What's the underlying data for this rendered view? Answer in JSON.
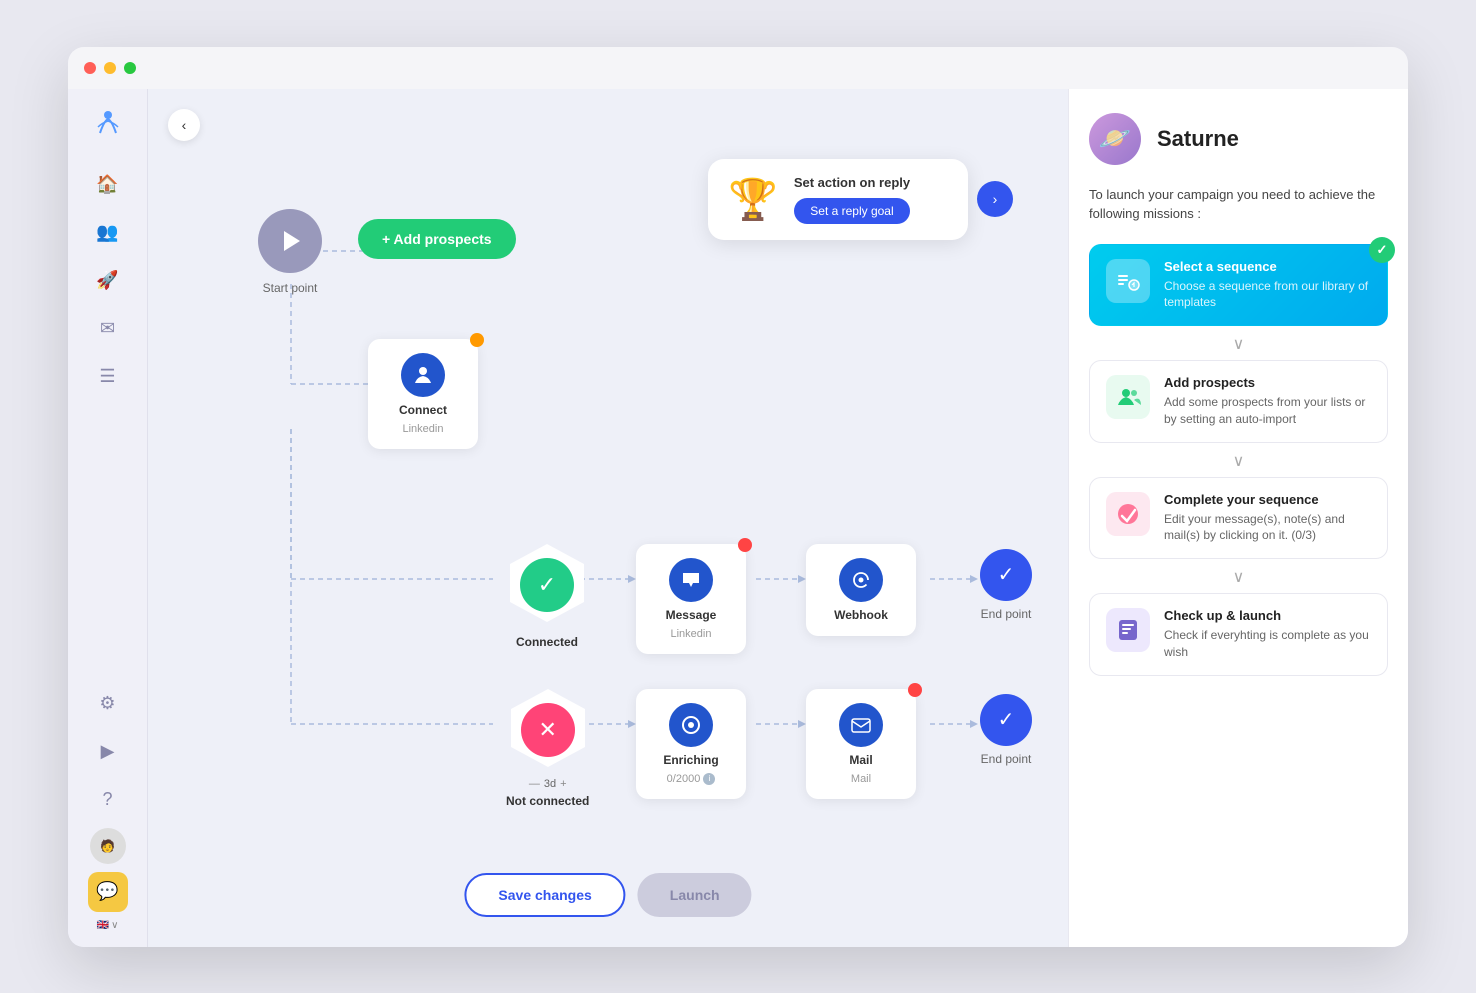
{
  "window": {
    "dots": [
      "red",
      "yellow",
      "green"
    ]
  },
  "sidebar": {
    "logo": "🦅",
    "icons": [
      {
        "name": "home-icon",
        "glyph": "⌂",
        "active": false
      },
      {
        "name": "users-icon",
        "glyph": "👥",
        "active": false
      },
      {
        "name": "rocket-icon",
        "glyph": "🚀",
        "active": true
      },
      {
        "name": "mail-icon",
        "glyph": "✉",
        "active": false
      },
      {
        "name": "list-icon",
        "glyph": "☰",
        "active": false
      },
      {
        "name": "settings-icon",
        "glyph": "⚙",
        "active": false
      },
      {
        "name": "play-icon",
        "glyph": "▶",
        "active": false
      },
      {
        "name": "help-icon",
        "glyph": "?",
        "active": false
      }
    ],
    "avatar_emoji": "🧑",
    "highlight_emoji": "💬",
    "lang": "EN"
  },
  "back_button": "‹",
  "action_card": {
    "trophy": "🏆",
    "title": "Set action on reply",
    "button_label": "Set a reply goal"
  },
  "next_button": "›",
  "start_node": {
    "label": "Start point"
  },
  "add_prospects": {
    "label": "+ Add prospects"
  },
  "connect_node": {
    "label": "Connect",
    "sublabel": "Linkedin",
    "color": "#2255cc"
  },
  "connected_node": {
    "label": "Connected"
  },
  "not_connected_node": {
    "label": "Not connected",
    "time": "3d"
  },
  "message_node": {
    "label": "Message",
    "sublabel": "Linkedin",
    "color": "#2255cc"
  },
  "enriching_node": {
    "label": "Enriching",
    "sublabel": "0/2000",
    "color": "#2255cc"
  },
  "webhook_node": {
    "label": "Webhook",
    "color": "#2255cc"
  },
  "mail_node": {
    "label": "Mail",
    "sublabel": "Mail",
    "color": "#2255cc"
  },
  "end_points": {
    "label": "End point"
  },
  "buttons": {
    "save": "Save changes",
    "launch": "Launch"
  },
  "right_panel": {
    "title": "Saturne",
    "avatar": "🪐",
    "subtitle": "To launch your campaign you need to achieve the following missions :",
    "missions": [
      {
        "id": "select-sequence",
        "icon": "🗂",
        "icon_bg": "blue-bg",
        "title": "Select a sequence",
        "desc": "Choose a sequence from our library of templates",
        "active": true,
        "completed": true
      },
      {
        "id": "add-prospects",
        "icon": "👤",
        "icon_bg": "green-bg",
        "title": "Add prospects",
        "desc": "Add some prospects from your lists or by setting an auto-import",
        "active": false,
        "completed": false
      },
      {
        "id": "complete-sequence",
        "icon": "✏️",
        "icon_bg": "pink-bg",
        "title": "Complete your sequence",
        "desc": "Edit your message(s), note(s) and mail(s) by clicking on it. (0/3)",
        "active": false,
        "completed": false
      },
      {
        "id": "checkup-launch",
        "icon": "🖥",
        "icon_bg": "purple-bg",
        "title": "Check up & launch",
        "desc": "Check if everyhting is complete as you wish",
        "active": false,
        "completed": false
      }
    ]
  }
}
